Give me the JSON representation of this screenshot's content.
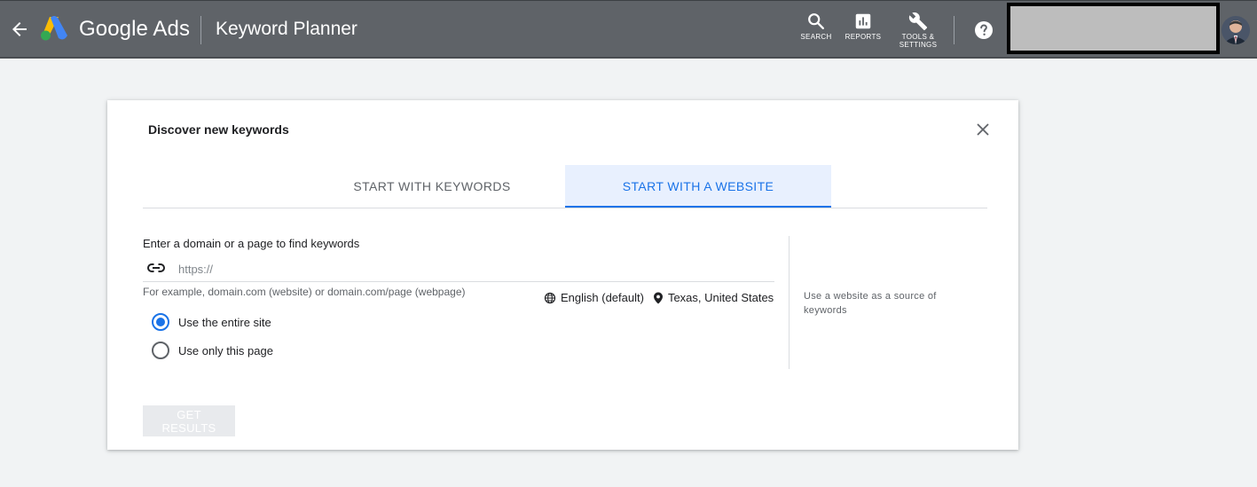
{
  "header": {
    "brand": "Google Ads",
    "page_name": "Keyword Planner",
    "tools": {
      "search": "SEARCH",
      "reports": "REPORTS",
      "settings": "TOOLS &\nSETTINGS"
    },
    "icons": [
      "back-arrow-icon",
      "google-ads-logo",
      "search-icon",
      "reports-icon",
      "wrench-icon",
      "help-icon"
    ]
  },
  "dialog": {
    "title": "Discover new keywords",
    "tabs": [
      {
        "label": "START WITH KEYWORDS",
        "active": false
      },
      {
        "label": "START WITH A WEBSITE",
        "active": true
      }
    ],
    "url_label": "Enter a domain or a page to find keywords",
    "url_placeholder": "https://",
    "helper": "For example, domain.com (website) or domain.com/page (webpage)",
    "language": "English (default)",
    "location": "Texas, United States",
    "scope_options": [
      {
        "label": "Use the entire site",
        "selected": true
      },
      {
        "label": "Use only this page",
        "selected": false
      }
    ],
    "side_note": "Use a website as a source of keywords",
    "submit_label": "GET RESULTS"
  },
  "colors": {
    "topbar": "#5f6368",
    "accent": "#1a73e8",
    "active_tab_bg": "#e8f0fe",
    "disabled_button": "#e8eaed"
  }
}
